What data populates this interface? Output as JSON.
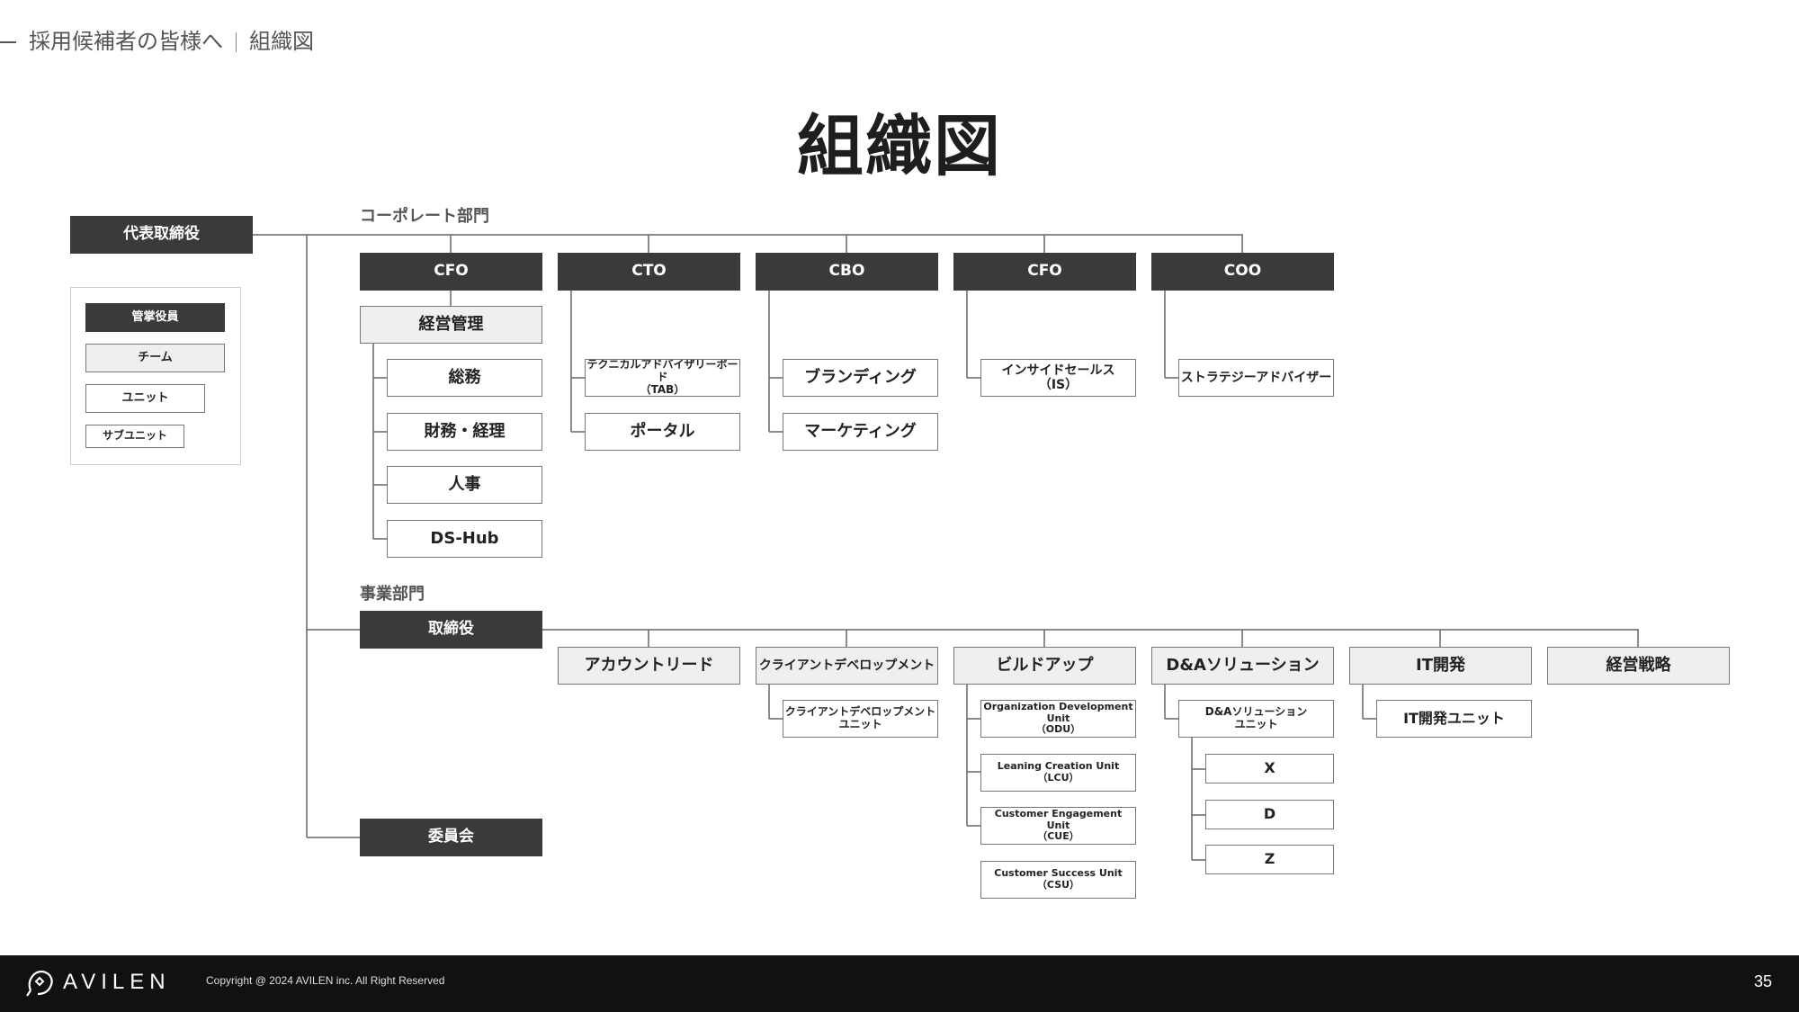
{
  "breadcrumb": {
    "section": "採用候補者の皆様へ",
    "page": "組織図"
  },
  "title": "組織図",
  "top": {
    "ceo": "代表取締役"
  },
  "legend": {
    "exec": "管掌役員",
    "team": "チーム",
    "unit": "ユニット",
    "subunit": "サブユニット"
  },
  "corporate": {
    "label": "コーポレート部門",
    "execs": [
      "CFO",
      "CTO",
      "CBO",
      "CFO",
      "COO"
    ],
    "team": "経営管理",
    "cfo_units": [
      "総務",
      "財務・経理",
      "人事",
      "DS-Hub"
    ],
    "cto_units": [
      "テクニカルアドバイザリーボード\n（TAB）",
      "ポータル"
    ],
    "cbo_units": [
      "ブランディング",
      "マーケティング"
    ],
    "cfo2_units": [
      "インサイドセールス\n（IS）"
    ],
    "coo_units": [
      "ストラテジーアドバイザー"
    ]
  },
  "business": {
    "label": "事業部門",
    "exec": "取締役",
    "teams": [
      "アカウントリード",
      "クライアントデベロップメント",
      "ビルドアップ",
      "D&Aソリューション",
      "IT開発",
      "経営戦略"
    ],
    "cd_units": [
      "クライアントデベロップメント\nユニット"
    ],
    "buildup_units": [
      "Organization Development Unit\n（ODU）",
      "Leaning Creation Unit\n（LCU）",
      "Customer Engagement Unit\n（CUE）",
      "Customer Success Unit\n（CSU）"
    ],
    "da_unit": "D&Aソリューション\nユニット",
    "da_subunits": [
      "X",
      "D",
      "Z"
    ],
    "it_units": [
      "IT開発ユニット"
    ]
  },
  "committee": "委員会",
  "footer": {
    "brand": "AVILEN",
    "copyright": "Copyright @ 2024 AVILEN inc. All Right Reserved",
    "page_number": "35"
  }
}
